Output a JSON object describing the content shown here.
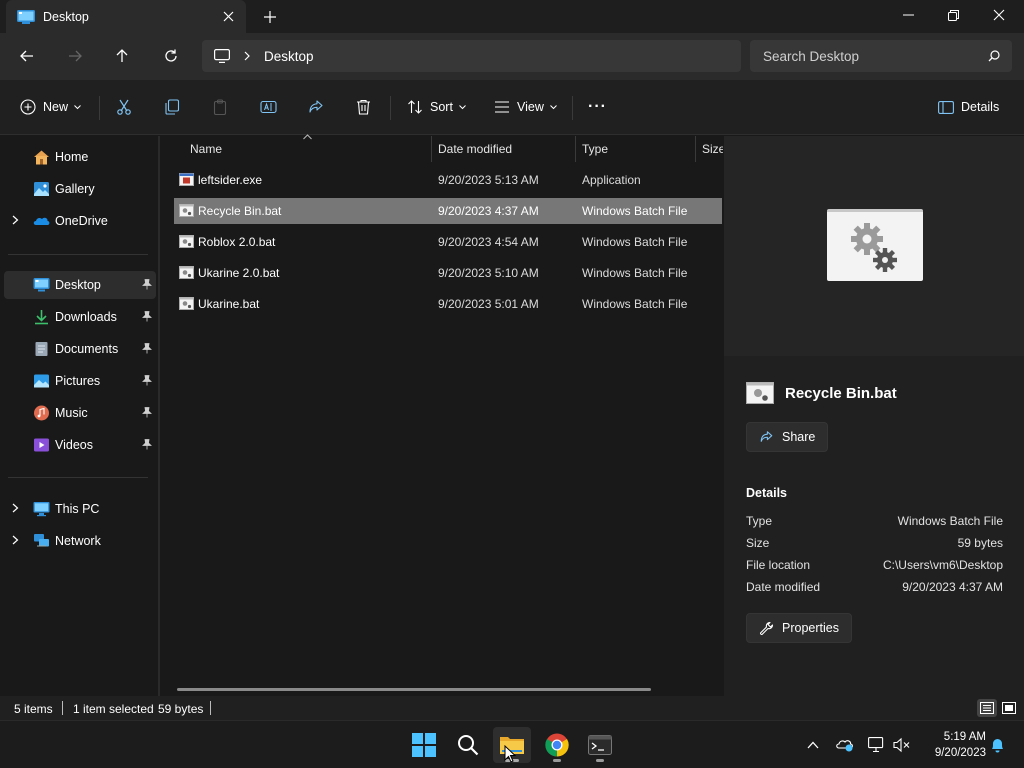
{
  "window": {
    "tab_title": "Desktop",
    "new_tab_symbol": "+"
  },
  "nav": {
    "breadcrumb": [
      "Desktop"
    ],
    "search_placeholder": "Search Desktop"
  },
  "toolbar": {
    "new_label": "New",
    "sort_label": "Sort",
    "view_label": "View",
    "more_label": "···",
    "details_label": "Details"
  },
  "sidebar": {
    "quick": [
      {
        "label": "Home",
        "icon": "home-icon"
      },
      {
        "label": "Gallery",
        "icon": "gallery-icon"
      },
      {
        "label": "OneDrive",
        "icon": "onedrive-icon"
      }
    ],
    "pinned": [
      {
        "label": "Desktop",
        "icon": "desktop-icon"
      },
      {
        "label": "Downloads",
        "icon": "downloads-icon"
      },
      {
        "label": "Documents",
        "icon": "documents-icon"
      },
      {
        "label": "Pictures",
        "icon": "pictures-icon"
      },
      {
        "label": "Music",
        "icon": "music-icon"
      },
      {
        "label": "Videos",
        "icon": "videos-icon"
      }
    ],
    "locations": [
      {
        "label": "This PC",
        "icon": "this-pc-icon"
      },
      {
        "label": "Network",
        "icon": "network-icon"
      }
    ]
  },
  "columns": {
    "name": "Name",
    "date": "Date modified",
    "type": "Type",
    "size": "Size"
  },
  "files": [
    {
      "name": "leftsider.exe",
      "date": "9/20/2023 5:13 AM",
      "type": "Application"
    },
    {
      "name": "Recycle Bin.bat",
      "date": "9/20/2023 4:37 AM",
      "type": "Windows Batch File"
    },
    {
      "name": "Roblox 2.0.bat",
      "date": "9/20/2023 4:54 AM",
      "type": "Windows Batch File"
    },
    {
      "name": "Ukarine 2.0.bat",
      "date": "9/20/2023 5:10 AM",
      "type": "Windows Batch File"
    },
    {
      "name": "Ukarine.bat",
      "date": "9/20/2023 5:01 AM",
      "type": "Windows Batch File"
    }
  ],
  "details_pane": {
    "title": "Recycle Bin.bat",
    "share_label": "Share",
    "section_label": "Details",
    "properties": [
      {
        "key": "Type",
        "value": "Windows Batch File"
      },
      {
        "key": "Size",
        "value": "59 bytes"
      },
      {
        "key": "File location",
        "value": "C:\\Users\\vm6\\Desktop"
      },
      {
        "key": "Date modified",
        "value": "9/20/2023 4:37 AM"
      }
    ],
    "properties_label": "Properties"
  },
  "status": {
    "items_count": "5 items",
    "selection": "1 item selected",
    "selection_size": "59 bytes"
  },
  "clock": {
    "time": "5:19 AM",
    "date": "9/20/2023"
  },
  "colors": {
    "selection": "#777777",
    "accent": "#4cc2ff",
    "background": "#191919"
  }
}
